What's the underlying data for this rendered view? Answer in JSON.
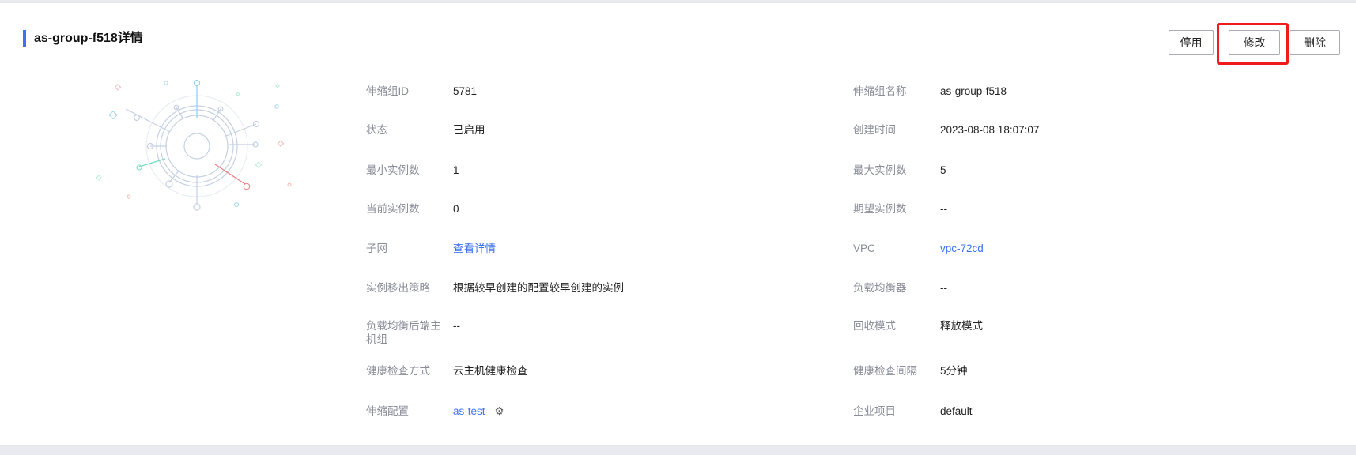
{
  "title": "as-group-f518详情",
  "buttons": {
    "disable": "停用",
    "modify": "修改",
    "delete": "删除"
  },
  "left": [
    {
      "label": "伸缩组ID",
      "value": "5781"
    },
    {
      "label": "状态",
      "value": "已启用"
    },
    {
      "label": "最小实例数",
      "value": "1"
    },
    {
      "label": "当前实例数",
      "value": "0"
    },
    {
      "label": "子网",
      "value": "查看详情",
      "link": true
    },
    {
      "label": "实例移出策略",
      "value": "根据较早创建的配置较早创建的实例"
    },
    {
      "label": "负载均衡后端主机组",
      "value": "--"
    },
    {
      "label": "健康检查方式",
      "value": "云主机健康检查"
    },
    {
      "label": "伸缩配置",
      "value": "as-test",
      "link": true,
      "icon": "gear-icon"
    }
  ],
  "right": [
    {
      "label": "伸缩组名称",
      "value": "as-group-f518"
    },
    {
      "label": "创建时间",
      "value": "2023-08-08 18:07:07"
    },
    {
      "label": "最大实例数",
      "value": "5"
    },
    {
      "label": "期望实例数",
      "value": "--"
    },
    {
      "label": "VPC",
      "value": "vpc-72cd",
      "link": true
    },
    {
      "label": "负载均衡器",
      "value": "--"
    },
    {
      "label": "回收模式",
      "value": "释放模式"
    },
    {
      "label": "健康检查间隔",
      "value": "5分钟"
    },
    {
      "label": "企业项目",
      "value": "default"
    }
  ],
  "colors": {
    "accent": "#3e73f0",
    "highlight": "#f01c1c"
  }
}
